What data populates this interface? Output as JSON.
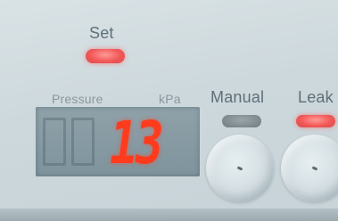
{
  "panel": {
    "set_label": "Set",
    "pressure_label": "Pressure",
    "unit_label": "kPa",
    "display_value": "13",
    "manual_label": "Manual",
    "leak_label": "Leak"
  },
  "indicators": {
    "set": "on",
    "manual": "off",
    "leak": "on"
  },
  "colors": {
    "led_on": "#f25858",
    "led_off": "#6f7b80",
    "digit": "#ff3b1e"
  },
  "icons": [
    "manual-knob",
    "leak-knob"
  ]
}
